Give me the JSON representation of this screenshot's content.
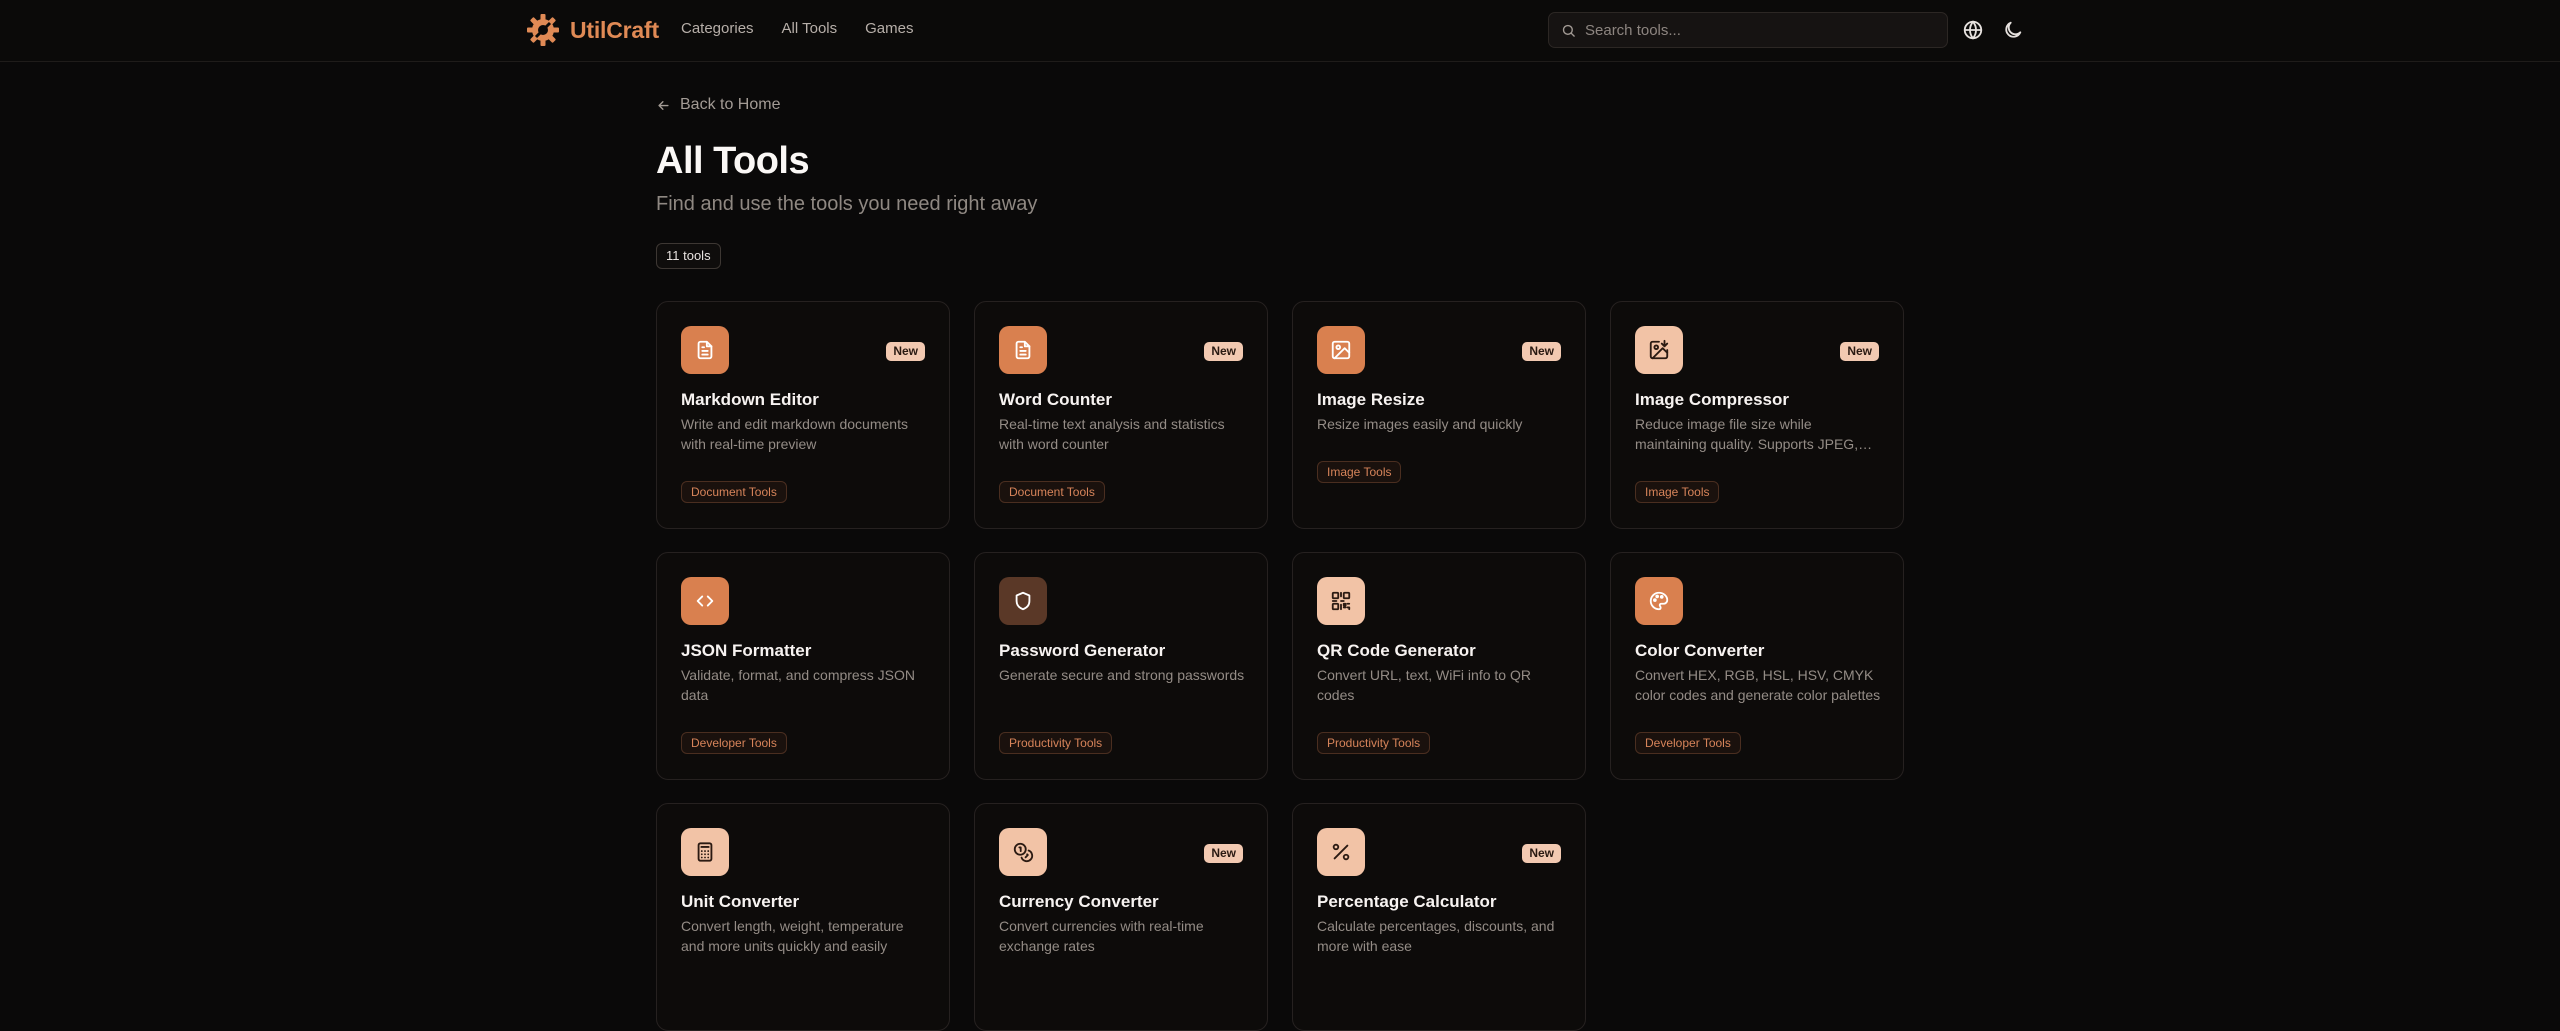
{
  "header": {
    "brand_name": "UtilCraft",
    "nav": [
      "Categories",
      "All Tools",
      "Games"
    ],
    "search_placeholder": "Search tools..."
  },
  "page": {
    "back_label": "Back to Home",
    "title": "All Tools",
    "subtitle": "Find and use the tools you need right away",
    "count_label": "11 tools"
  },
  "colors": {
    "accent": "#e08a55",
    "icon_orange": "#d9804f",
    "icon_peach": "#f2c3a6",
    "icon_brown": "#5a3827",
    "background": "#0a0909"
  },
  "tools": [
    {
      "name": "Markdown Editor",
      "desc": "Write and edit markdown documents with real-time preview",
      "category": "Document Tools",
      "badge": "New",
      "icon": "document-icon"
    },
    {
      "name": "Word Counter",
      "desc": "Real-time text analysis and statistics with word counter",
      "category": "Document Tools",
      "badge": "New",
      "icon": "document-icon"
    },
    {
      "name": "Image Resize",
      "desc": "Resize images easily and quickly",
      "category": "Image Tools",
      "badge": "New",
      "icon": "image-icon"
    },
    {
      "name": "Image Compressor",
      "desc": "Reduce image file size while maintaining quality. Supports JPEG, PNG, WebP and more",
      "category": "Image Tools",
      "badge": "New",
      "icon": "image-compress-icon"
    },
    {
      "name": "JSON Formatter",
      "desc": "Validate, format, and compress JSON data",
      "category": "Developer Tools",
      "badge": "",
      "icon": "code-icon"
    },
    {
      "name": "Password Generator",
      "desc": "Generate secure and strong passwords",
      "category": "Productivity Tools",
      "badge": "",
      "icon": "shield-icon"
    },
    {
      "name": "QR Code Generator",
      "desc": "Convert URL, text, WiFi info to QR codes",
      "category": "Productivity Tools",
      "badge": "",
      "icon": "qr-code-icon"
    },
    {
      "name": "Color Converter",
      "desc": "Convert HEX, RGB, HSL, HSV, CMYK color codes and generate color palettes",
      "category": "Developer Tools",
      "badge": "",
      "icon": "palette-icon"
    },
    {
      "name": "Unit Converter",
      "desc": "Convert length, weight, temperature and more units quickly and easily",
      "category": "",
      "badge": "",
      "icon": "calculator-icon"
    },
    {
      "name": "Currency Converter",
      "desc": "Convert currencies with real-time exchange rates",
      "category": "",
      "badge": "New",
      "icon": "coins-icon"
    },
    {
      "name": "Percentage Calculator",
      "desc": "Calculate percentages, discounts, and more with ease",
      "category": "",
      "badge": "New",
      "icon": "percent-icon"
    }
  ]
}
